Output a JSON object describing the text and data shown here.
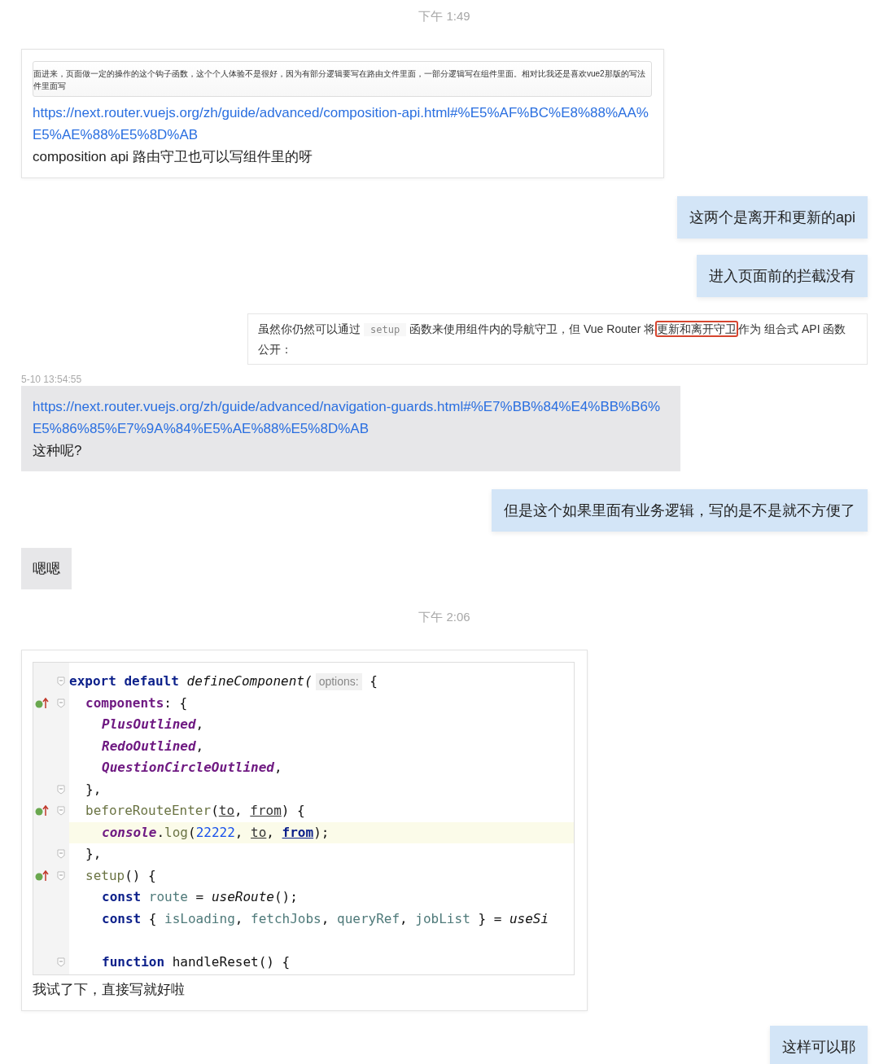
{
  "messages": [
    {
      "kind": "time",
      "text": "下午 1:49"
    },
    {
      "kind": "card",
      "quote_lines": [
        "面进来，页面做一定的操作的这个钩子函数，这个个人体验不是很好，因为有部分逻辑要写在路由文件里面，一部分逻辑写在组件里面。相对比我还是喜欢vue2那版的写法",
        "件里面写"
      ],
      "link": "https://next.router.vuejs.org/zh/guide/advanced/composition-api.html#%E5%AF%BC%E8%88%AA%E5%AE%88%E5%8D%AB",
      "text": "composition api 路由守卫也可以写组件里的呀"
    },
    {
      "kind": "sent",
      "text": "这两个是离开和更新的api"
    },
    {
      "kind": "sent",
      "text": "进入页面前的拦截没有"
    },
    {
      "kind": "doc",
      "segments": [
        {
          "kind": "text",
          "text": "虽然你仍然可以通过"
        },
        {
          "kind": "code",
          "text": "setup"
        },
        {
          "kind": "text",
          "text": "函数来使用组件内的导航守卫，但 Vue Router 将"
        },
        {
          "kind": "highlight",
          "text": "更新和离开守卫"
        },
        {
          "kind": "text",
          "text": "作为 组合式 API 函数公开："
        }
      ]
    },
    {
      "kind": "stamp",
      "text": "5-10 13:54:55"
    },
    {
      "kind": "grey",
      "link": "https://next.router.vuejs.org/zh/guide/advanced/navigation-guards.html#%E7%BB%84%E4%BB%B6%E5%86%85%E7%9A%84%E5%AE%88%E5%8D%AB",
      "text": "这种呢?"
    },
    {
      "kind": "sent",
      "text": "但是这个如果里面有业务逻辑，写的是不是就不方便了"
    },
    {
      "kind": "grey",
      "text": "嗯嗯"
    },
    {
      "kind": "time",
      "text": "下午 2:06"
    },
    {
      "kind": "codecard",
      "text": "我试了下，直接写就好啦",
      "code": [
        {
          "fold": true,
          "tokens": [
            {
              "kind": "kw",
              "t": "export default "
            },
            {
              "kind": "it",
              "t": "defineComponent("
            },
            {
              "kind": "hint",
              "t": "options:"
            },
            {
              "kind": "p",
              "t": " {"
            }
          ],
          "children": [
            {
              "fold": true,
              "marker": true,
              "tokens": [
                {
                  "kind": "prop",
                  "t": "components"
                },
                {
                  "kind": "p",
                  "t": ": {"
                }
              ],
              "children": [
                {
                  "tokens": [
                    {
                      "kind": "propi",
                      "t": "PlusOutlined"
                    },
                    {
                      "kind": "p",
                      "t": ","
                    }
                  ]
                },
                {
                  "tokens": [
                    {
                      "kind": "propi",
                      "t": "RedoOutlined"
                    },
                    {
                      "kind": "p",
                      "t": ","
                    }
                  ]
                },
                {
                  "tokens": [
                    {
                      "kind": "propi",
                      "t": "QuestionCircleOutlined"
                    },
                    {
                      "kind": "p",
                      "t": ","
                    }
                  ]
                }
              ]
            },
            {
              "fold": true,
              "tokens": [
                {
                  "kind": "p",
                  "t": "},"
                }
              ]
            },
            {
              "fold": true,
              "marker": true,
              "tokens": [
                {
                  "kind": "ol",
                  "t": "beforeRouteEnter"
                },
                {
                  "kind": "p",
                  "t": "("
                },
                {
                  "kind": "par",
                  "t": "to"
                },
                {
                  "kind": "p",
                  "t": ", "
                },
                {
                  "kind": "par",
                  "t": "from"
                },
                {
                  "kind": "p",
                  "t": ") {"
                }
              ],
              "children": [
                {
                  "highlighted": true,
                  "tokens": [
                    {
                      "kind": "propi",
                      "t": "console"
                    },
                    {
                      "kind": "p",
                      "t": "."
                    },
                    {
                      "kind": "ol",
                      "t": "log"
                    },
                    {
                      "kind": "p",
                      "t": "("
                    },
                    {
                      "kind": "num",
                      "t": "22222"
                    },
                    {
                      "kind": "p",
                      "t": ", "
                    },
                    {
                      "kind": "par",
                      "t": "to"
                    },
                    {
                      "kind": "p",
                      "t": ", "
                    },
                    {
                      "kind": "parb",
                      "t": "from"
                    },
                    {
                      "kind": "p",
                      "t": ");"
                    }
                  ]
                }
              ]
            },
            {
              "fold": true,
              "tokens": [
                {
                  "kind": "p",
                  "t": "},"
                }
              ]
            },
            {
              "fold": true,
              "marker": true,
              "tokens": [
                {
                  "kind": "ol",
                  "t": "setup"
                },
                {
                  "kind": "p",
                  "t": "() {"
                }
              ],
              "children": [
                {
                  "tokens": [
                    {
                      "kind": "kw",
                      "t": "const "
                    },
                    {
                      "kind": "var",
                      "t": "route"
                    },
                    {
                      "kind": "p",
                      "t": " = "
                    },
                    {
                      "kind": "it",
                      "t": "useRoute"
                    },
                    {
                      "kind": "p",
                      "t": "();"
                    }
                  ]
                },
                {
                  "tokens": [
                    {
                      "kind": "kw",
                      "t": "const "
                    },
                    {
                      "kind": "p",
                      "t": "{ "
                    },
                    {
                      "kind": "var",
                      "t": "isLoading"
                    },
                    {
                      "kind": "p",
                      "t": ", "
                    },
                    {
                      "kind": "var",
                      "t": "fetchJobs"
                    },
                    {
                      "kind": "p",
                      "t": ", "
                    },
                    {
                      "kind": "var",
                      "t": "queryRef"
                    },
                    {
                      "kind": "p",
                      "t": ", "
                    },
                    {
                      "kind": "var",
                      "t": "jobList"
                    },
                    {
                      "kind": "p",
                      "t": " } = "
                    },
                    {
                      "kind": "it",
                      "t": "useSi"
                    }
                  ]
                },
                {
                  "kind": "blank"
                },
                {
                  "fold": true,
                  "tokens": [
                    {
                      "kind": "kw",
                      "t": "function "
                    },
                    {
                      "kind": "p",
                      "t": "handleReset() {"
                    }
                  ]
                }
              ]
            }
          ]
        }
      ]
    },
    {
      "kind": "sent",
      "text": "这样可以耶"
    }
  ]
}
